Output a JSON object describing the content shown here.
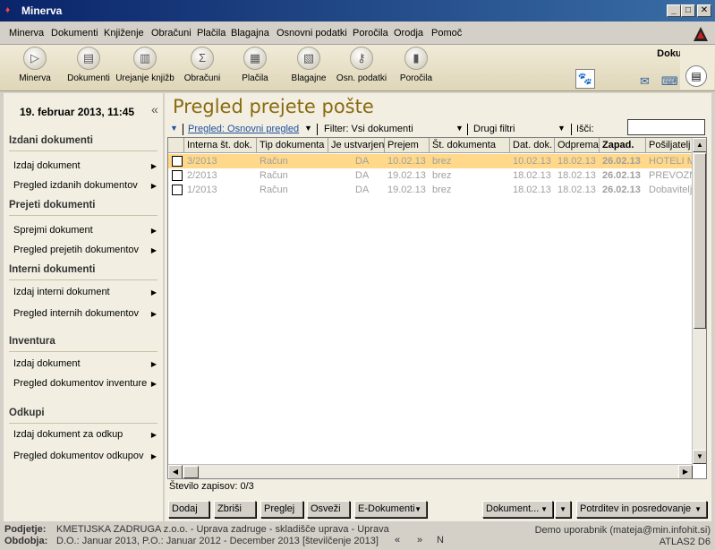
{
  "window": {
    "title": "Minerva"
  },
  "menu": [
    "Minerva",
    "Dokumenti",
    "Knjiženje",
    "Obračuni",
    "Plačila",
    "Blagajna",
    "Osnovni podatki",
    "Poročila",
    "Orodja",
    "Pomoč"
  ],
  "toolbar": {
    "items": [
      {
        "label": "Minerva",
        "icon": "play-icon"
      },
      {
        "label": "Dokumenti",
        "icon": "document-icon"
      },
      {
        "label": "Urejanje knjižb",
        "icon": "books-icon"
      },
      {
        "label": "Obračuni",
        "icon": "calculator-icon"
      },
      {
        "label": "Plačila",
        "icon": "payment-icon"
      },
      {
        "label": "Blagajne",
        "icon": "cashbox-icon"
      },
      {
        "label": "Osn. podatki",
        "icon": "key-icon"
      },
      {
        "label": "Poročila",
        "icon": "bar-chart-icon"
      }
    ],
    "active_module": "Dokumenti"
  },
  "left": {
    "datetime": "19. februar 2013, 11:45",
    "collapse": "«",
    "sections": [
      {
        "title": "Izdani dokumenti",
        "items": [
          "Izdaj dokument",
          "Pregled izdanih dokumentov"
        ]
      },
      {
        "title": "Prejeti dokumenti",
        "items": [
          "Sprejmi dokument",
          "Pregled prejetih dokumentov"
        ]
      },
      {
        "title": "Interni dokumenti",
        "items": [
          "Izdaj interni dokument",
          "Pregled internih dokumentov"
        ]
      },
      {
        "title": "Inventura",
        "items": [
          "Izdaj dokument",
          "Pregled dokumentov inventure"
        ]
      },
      {
        "title": "Odkupi",
        "items": [
          "Izdaj dokument za odkup",
          "Pregled dokumentov odkupov"
        ]
      }
    ]
  },
  "main": {
    "title": "Pregled prejete pošte",
    "view": "Pregled: Osnovni pregled",
    "filter": "Filter: Vsi dokumenti",
    "other_filters": "Drugi filtri",
    "search_label": "Išči:",
    "search_value": "",
    "columns": [
      "Interna št. dok.",
      "Tip dokumenta",
      "Je ustvarjen",
      "Prejem",
      "Št. dokumenta",
      "Dat. dok.",
      "Odprema",
      "Zapad.",
      "Pošiljatelj"
    ],
    "rows": [
      [
        "3/2013",
        "Račun",
        "DA",
        "10.02.13",
        "brez",
        "10.02.13",
        "18.02.13",
        "26.02.13",
        "HOTELI M"
      ],
      [
        "2/2013",
        "Račun",
        "DA",
        "19.02.13",
        "brez",
        "18.02.13",
        "18.02.13",
        "26.02.13",
        "PREVOZNI"
      ],
      [
        "1/2013",
        "Račun",
        "DA",
        "19.02.13",
        "brez",
        "18.02.13",
        "18.02.13",
        "26.02.13",
        "Dobavitelj"
      ]
    ],
    "record_count": "Število zapisov: 0/3",
    "buttons": {
      "add": "Dodaj",
      "delete": "Zbriši",
      "view": "Preglej",
      "refresh": "Osveži",
      "edocs": "E-Dokumenti",
      "document": "Dokument...",
      "confirm": "Potrditev in posredovanje"
    }
  },
  "status": {
    "company_label": "Podjetje:",
    "company": "KMETIJSKA ZADRUGA z.o.o. - Uprava zadruge - skladišče uprava - Uprava",
    "period_label": "Obdobja:",
    "period": "D.O.: Januar 2013, P.O.: Januar 2012 - December 2013 [številčenje 2013]",
    "nav_prev": "«",
    "nav_next": "»",
    "nav_n": "N",
    "user": "Demo uporabnik (mateja@min.infohit.si)",
    "version": "ATLAS2 D6"
  }
}
